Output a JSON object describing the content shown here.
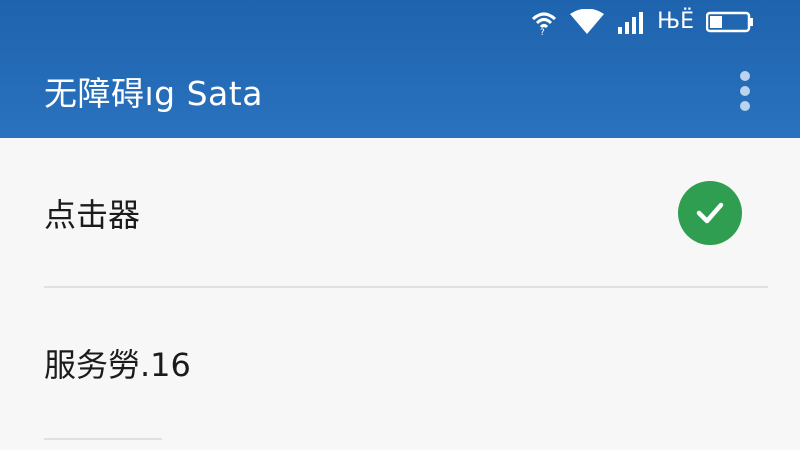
{
  "status_bar": {
    "icons": [
      "wifi-icon",
      "wifi-signal-icon",
      "cell-signal-icon",
      "data-activity-icon",
      "battery-icon"
    ],
    "data_glyph": "ЊЁ"
  },
  "app_bar": {
    "title": "无障碍ıg Sata",
    "menu_icon": "more-vert-icon"
  },
  "list": {
    "items": [
      {
        "label": "点击器",
        "status_icon": "check-circle-icon"
      },
      {
        "label": "服务勞.16"
      }
    ]
  },
  "colors": {
    "primary": "#2a72bf",
    "primary_dark": "#1e63ad",
    "check_green": "#2f9e50",
    "background": "#f7f7f7"
  }
}
